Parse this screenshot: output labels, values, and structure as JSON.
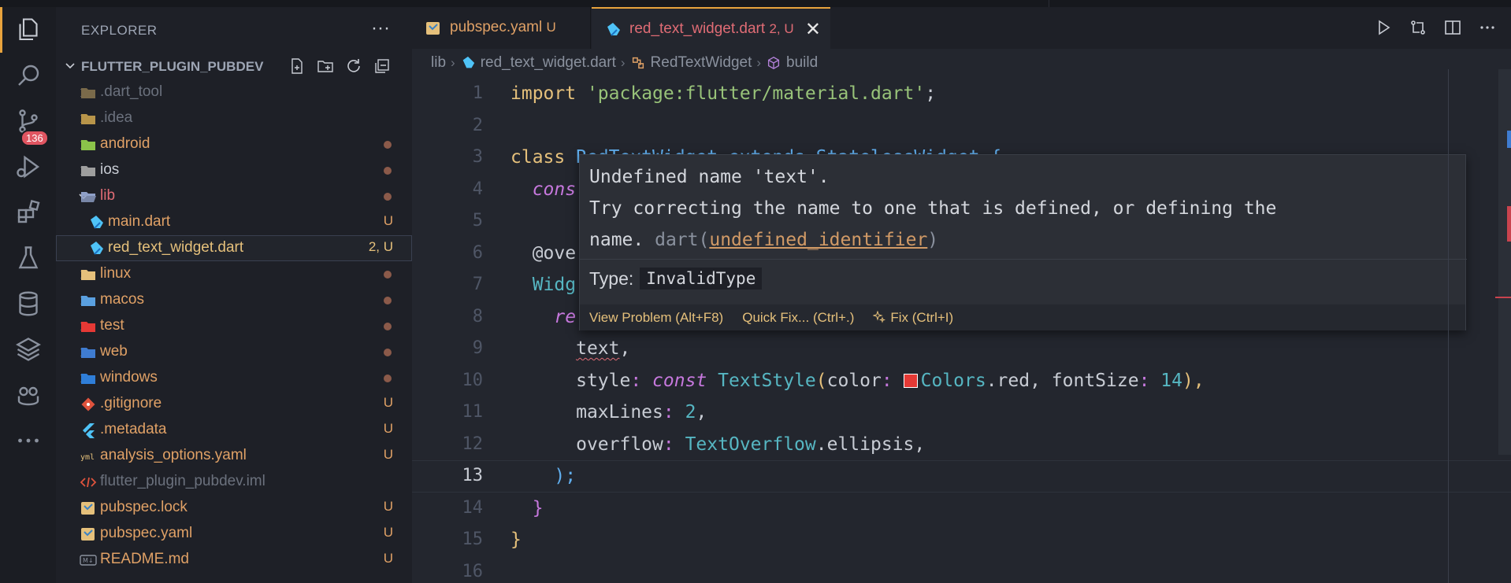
{
  "activity": {
    "scm_badge": "136",
    "items": [
      "explorer-icon",
      "search-icon",
      "source-control-icon",
      "run-debug-icon",
      "extensions-icon",
      "testing-icon",
      "database-icon",
      "layers-icon",
      "copilot-icon",
      "more-icon"
    ]
  },
  "sidebar": {
    "title": "EXPLORER",
    "more": "···",
    "root": "FLUTTER_PLUGIN_PUBDEV",
    "items": [
      {
        "label": ".dart_tool",
        "status": "",
        "kind": "folder",
        "color": "dim"
      },
      {
        "label": ".idea",
        "status": "",
        "kind": "folder",
        "color": "dim"
      },
      {
        "label": "android",
        "status": "",
        "kind": "folder",
        "color": "mod"
      },
      {
        "label": "ios",
        "status": "",
        "kind": "folder",
        "color": "default"
      },
      {
        "label": "lib",
        "status": "",
        "kind": "folder-open",
        "color": "err"
      },
      {
        "label": "main.dart",
        "status": "U",
        "kind": "dart",
        "color": "mod"
      },
      {
        "label": "red_text_widget.dart",
        "status": "2, U",
        "kind": "dart",
        "color": "warn"
      },
      {
        "label": "linux",
        "status": "",
        "kind": "folder",
        "color": "mod"
      },
      {
        "label": "macos",
        "status": "",
        "kind": "folder",
        "color": "mod"
      },
      {
        "label": "test",
        "status": "",
        "kind": "folder",
        "color": "mod"
      },
      {
        "label": "web",
        "status": "",
        "kind": "folder",
        "color": "mod"
      },
      {
        "label": "windows",
        "status": "",
        "kind": "folder",
        "color": "mod"
      },
      {
        "label": ".gitignore",
        "status": "U",
        "kind": "git",
        "color": "mod"
      },
      {
        "label": ".metadata",
        "status": "U",
        "kind": "flutter",
        "color": "mod"
      },
      {
        "label": "analysis_options.yaml",
        "status": "U",
        "kind": "yaml",
        "color": "mod"
      },
      {
        "label": "flutter_plugin_pubdev.iml",
        "status": "",
        "kind": "xml",
        "color": "dim"
      },
      {
        "label": "pubspec.lock",
        "status": "U",
        "kind": "lock",
        "color": "mod"
      },
      {
        "label": "pubspec.yaml",
        "status": "U",
        "kind": "yaml2",
        "color": "mod"
      },
      {
        "label": "README.md",
        "status": "U",
        "kind": "md",
        "color": "mod"
      }
    ]
  },
  "tabs": [
    {
      "label": "pubspec.yaml",
      "status": "U"
    },
    {
      "label": "red_text_widget.dart",
      "status": "2, U",
      "close": "✕"
    }
  ],
  "breadcrumb": [
    "lib",
    "red_text_widget.dart",
    "RedTextWidget",
    "build"
  ],
  "line_numbers": [
    "1",
    "2",
    "3",
    "4",
    "5",
    "6",
    "7",
    "8",
    "9",
    "10",
    "11",
    "12",
    "13",
    "14",
    "15",
    "16"
  ],
  "current_line": "13",
  "hover": {
    "line1": "Undefined name 'text'.",
    "line2": "Try correcting the name to one that is defined, or defining the",
    "line3_prefix": "name. ",
    "line3_source": "dart(",
    "line3_link": "undefined_identifier",
    "line3_end": ")",
    "type_label": "Type:",
    "type_value": "InvalidType",
    "actions": [
      "View Problem (Alt+F8)",
      "Quick Fix... (Ctrl+.)",
      "Fix (Ctrl+I)"
    ]
  },
  "code": {
    "l1_kw": "import",
    "l1_str": "'package:flutter/material.dart'",
    "l1_end": ";",
    "l3_kw": "class",
    "l3_rest": " RedTextWidget extends StatelessWidget {",
    "l4": "cons",
    "l6": "@ove",
    "l7": "Widg",
    "l8": "re",
    "l9_id": "text",
    "l9_end": ",",
    "l10_prop": "style",
    "l10_kw": "const",
    "l10_cls": "TextStyle",
    "l10_color": "color",
    "l10_colors": "Colors",
    "l10_red": ".red, ",
    "l10_fs": "fontSize",
    "l10_num": "14",
    "l10_end": "),",
    "l11_prop": "maxLines",
    "l11_num": "2",
    "l12_prop": "overflow",
    "l12_cls": "TextOverflow",
    "l12_rest": ".ellipsis,",
    "l13": ");",
    "l14": "}",
    "l15": "}"
  }
}
